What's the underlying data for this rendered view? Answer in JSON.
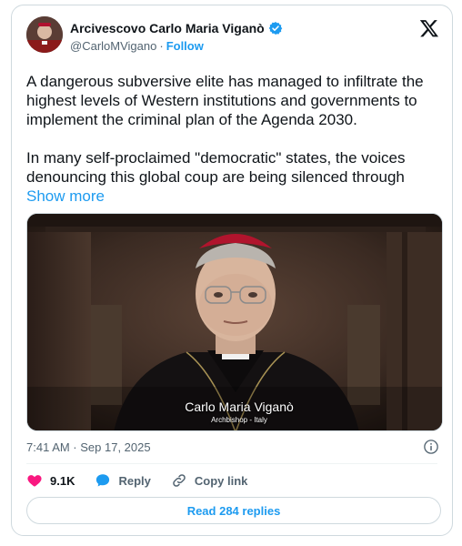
{
  "author": {
    "name": "Arcivescovo Carlo Maria Viganò",
    "handle": "@CarloMVigano",
    "separator": "·",
    "follow_label": "Follow"
  },
  "post": {
    "paragraph1": "A dangerous subversive elite has managed to infiltrate the highest levels of Western institutions and governments to implement the criminal plan of the Agenda 2030.",
    "paragraph2": "In many self-proclaimed \"democratic\" states, the voices denouncing this global coup are being silenced through",
    "show_more": "Show more"
  },
  "media": {
    "caption_name": "Carlo Maria Viganò",
    "caption_role": "Archbishop - Italy"
  },
  "timestamp": "7:41 AM · Sep 17, 2025",
  "actions": {
    "likes": "9.1K",
    "reply_label": "Reply",
    "copy_link_label": "Copy link"
  },
  "replies_button": "Read 284 replies",
  "colors": {
    "accent": "#1d9bf0",
    "like": "#f91880",
    "text": "#0f1419",
    "muted": "#536471"
  },
  "icons": [
    "x-logo-icon",
    "verified-badge-icon",
    "info-icon",
    "heart-icon",
    "reply-icon",
    "link-icon"
  ]
}
